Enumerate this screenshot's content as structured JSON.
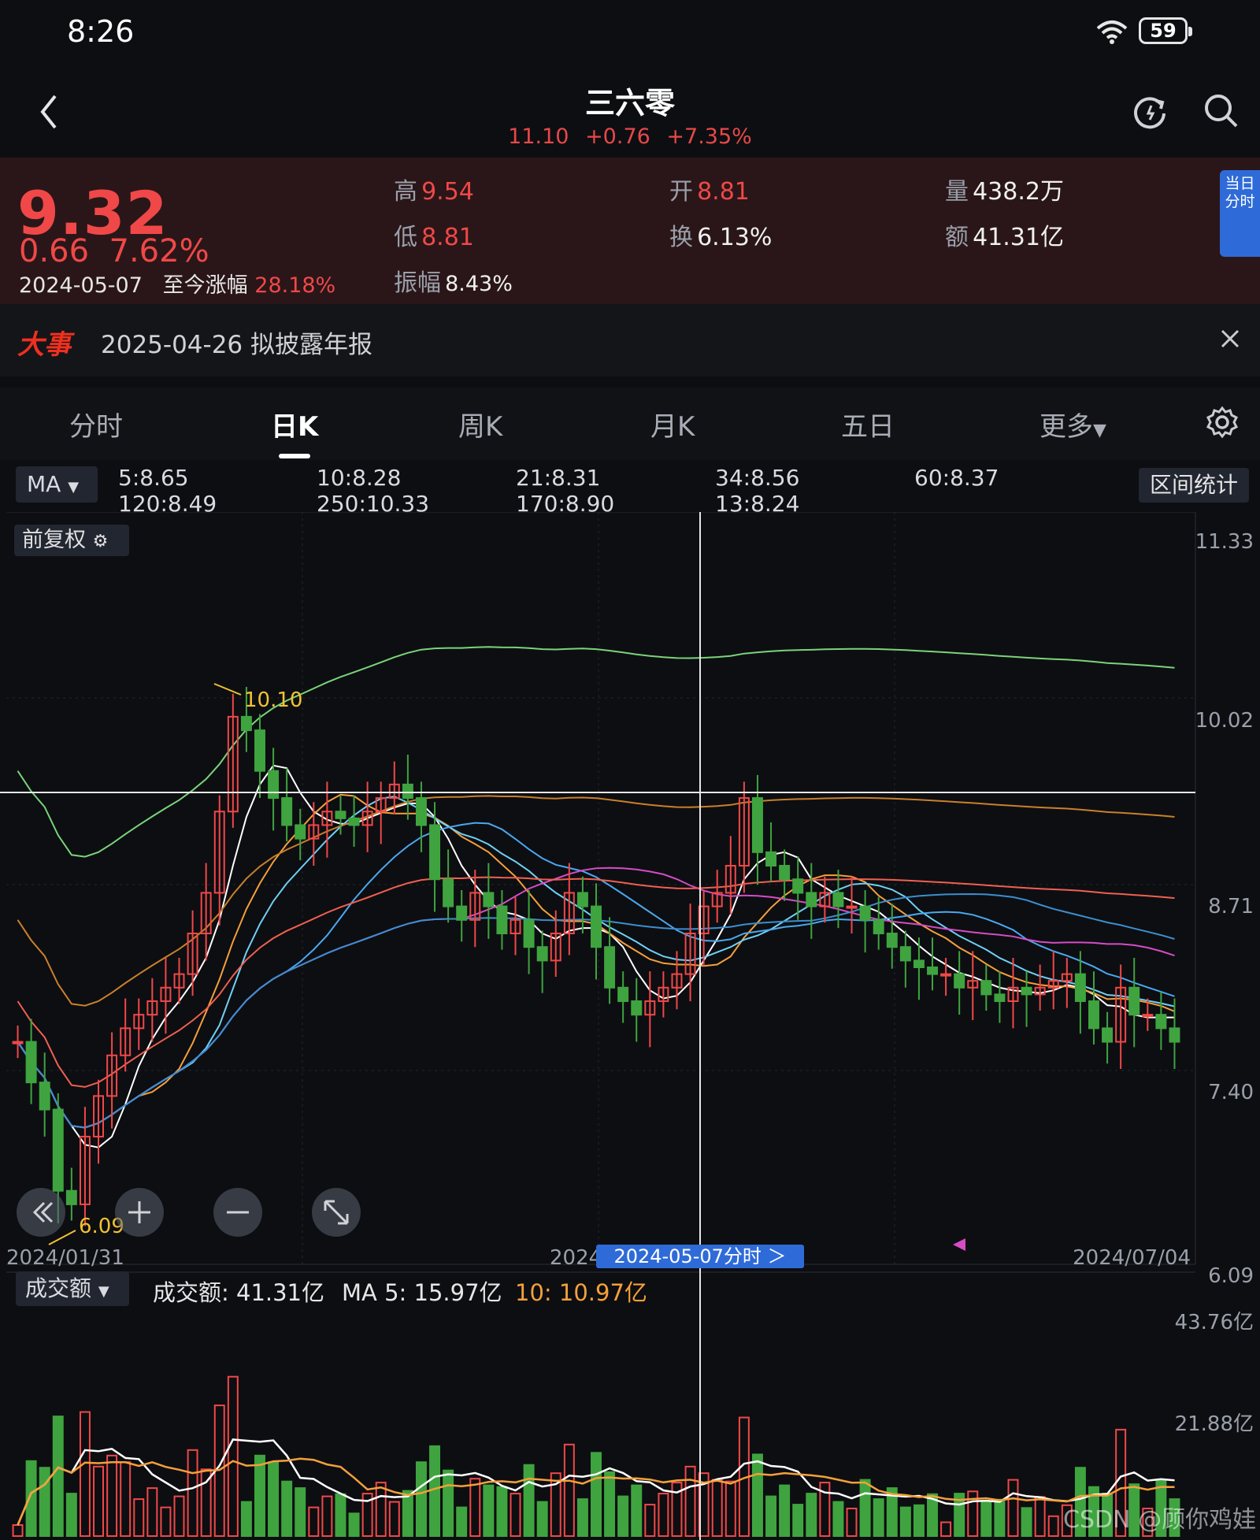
{
  "status": {
    "time": "8:26",
    "battery": "59"
  },
  "header": {
    "title": "三六零",
    "price": "11.10",
    "change": "+0.76",
    "pct": "+7.35%"
  },
  "quote": {
    "price": "9.32",
    "change": "0.66",
    "pct": "7.62%",
    "date": "2024-05-07",
    "since_label": "至今涨幅",
    "since_value": "28.18%",
    "high_label": "高",
    "high": "9.54",
    "low_label": "低",
    "low": "8.81",
    "amp_label": "振幅",
    "amp": "8.43%",
    "open_label": "开",
    "open": "8.81",
    "turnover_label": "换",
    "turnover": "6.13%",
    "volume_label": "量",
    "volume": "438.2万",
    "amount_label": "额",
    "amount": "41.31亿",
    "side_tab": "当日分时"
  },
  "event": {
    "logo": "大事",
    "text": "2025-04-26 拟披露年报"
  },
  "tabs": [
    "分时",
    "日K",
    "周K",
    "月K",
    "五日",
    "更多"
  ],
  "ma": {
    "selector": "MA",
    "items": [
      {
        "label": "5:8.65",
        "color": "#ffffff"
      },
      {
        "label": "10:8.28",
        "color": "#f5a03a"
      },
      {
        "label": "21:8.31",
        "color": "#4aa8f0"
      },
      {
        "label": "34:8.56",
        "color": "#d54cc5"
      },
      {
        "label": "60:8.37",
        "color": "#3b8fcf"
      },
      {
        "label": "120:8.49",
        "color": "#f06050"
      },
      {
        "label": "250:10.33",
        "color": "#7ad47a"
      },
      {
        "label": "170:8.90",
        "color": "#c9802a"
      },
      {
        "label": "13:8.24",
        "color": "#6fd0f5"
      }
    ],
    "range_btn": "区间统计",
    "adjust_btn": "前复权"
  },
  "chart_data": {
    "type": "candlestick",
    "price_axis": [
      "11.33",
      "10.02",
      "8.71",
      "7.40",
      "6.09"
    ],
    "x_labels": [
      "2024/01/31",
      "2024/",
      "2024/07/04"
    ],
    "max_label": "10.10",
    "min_label": "6.09",
    "crosshair_date": "2024-05-07分时 ＞",
    "ylim": [
      6.09,
      11.33
    ]
  },
  "volume": {
    "selector": "成交额",
    "amount_text": "成交额: 41.31亿",
    "ma5_text": "MA 5: 15.97亿",
    "ma10_text": "10: 10.97亿",
    "axis": [
      "43.76亿",
      "21.88亿"
    ]
  },
  "watermark": "CSDN @顾你鸡娃",
  "colors": {
    "up": "#f04848",
    "down": "#3fa43f",
    "accent": "#2f6bd8"
  }
}
